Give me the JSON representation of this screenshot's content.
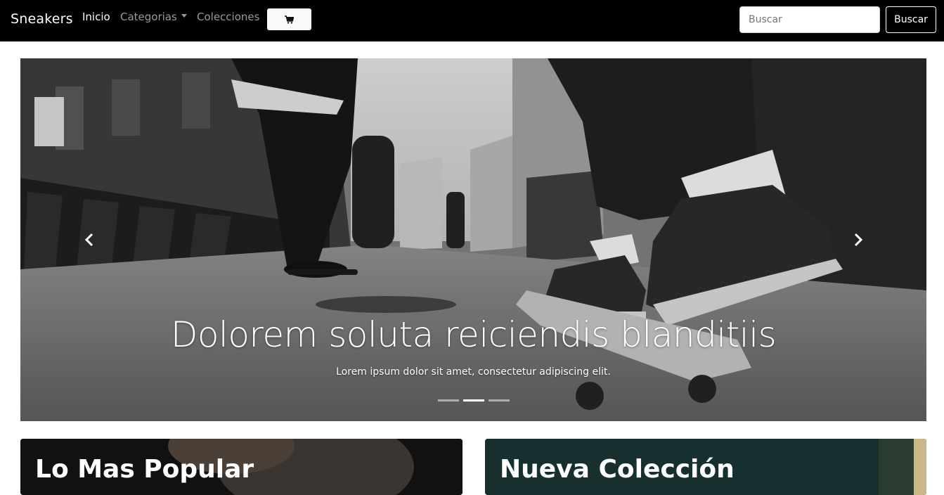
{
  "navbar": {
    "brand": "Sneakers",
    "links": [
      {
        "label": "Inicio",
        "active": true
      },
      {
        "label": "Categorias",
        "dropdown": true
      },
      {
        "label": "Colecciones"
      }
    ],
    "cart_icon": "shopping-cart-icon",
    "search": {
      "placeholder": "Buscar",
      "value": "",
      "button_label": "Buscar"
    }
  },
  "carousel": {
    "title": "Dolorem soluta reiciendis blanditiis",
    "text": "Lorem ipsum dolor sit amet, consectetur adipiscing elit.",
    "prev_icon": "chevron-left-icon",
    "next_icon": "chevron-right-icon",
    "slide_count": 3,
    "active_slide": 2
  },
  "cards": [
    {
      "title": "Lo Mas Popular"
    },
    {
      "title": "Nueva Colección"
    }
  ],
  "colors": {
    "navbar_bg": "#000000",
    "text_light": "#ffffff",
    "link_muted": "#9a9a9a"
  }
}
